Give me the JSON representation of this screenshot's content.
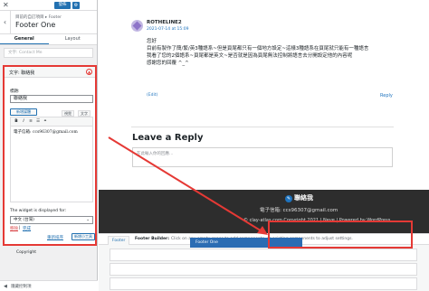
{
  "sidebar": {
    "publish_label": "發佈",
    "breadcrumb": "目前的自訂項目 ▸ Footer",
    "title": "Footer One",
    "tabs": [
      {
        "label": "General",
        "active": true
      },
      {
        "label": "Layout",
        "active": false
      }
    ],
    "contact_item": "文字: Contact Me",
    "bottom_label": "隱藏控制項"
  },
  "widget": {
    "header_label": "文字: 聯絡我",
    "title_label": "標題:",
    "title_value": "聯絡我",
    "add_media_label": "新增媒體",
    "visual_tab": "視覺",
    "text_tab": "文字",
    "editor_content": "電子信箱: ccs96307@gmail.com",
    "display_label": "The widget is displayed for:",
    "display_value": "中文 (台灣)",
    "remove_link": "移除",
    "separator": "|",
    "done_link": "完成",
    "reorder_link": "重新排序",
    "add_widget_label": "新增小工具"
  },
  "comment": {
    "author": "ROTHELINE2",
    "date": "2021-07-14 at 15:09",
    "line1": "您好",
    "line2": "目前有製作了簡/繁/英3種語系~但是頁尾都只有一個地方設定~這樣3種語系在頁尾就只能有一種語言",
    "line3": "我看了您的2個語系~頁尾都是英文~是否就是因為頁尾無法控制將語言去分開設定他的內容呢",
    "line4": "感謝您的回覆 ^_^",
    "edit_label": "(Edit)",
    "reply_label": "Reply"
  },
  "leave_reply": {
    "title": "Leave a Reply",
    "placeholder": "在此輸入你的回應…"
  },
  "site_footer": {
    "widget_title": "聯絡我",
    "email_line": "電子信箱: ccs96307@gmail.com",
    "copyright_line": "© clay-atlas.com Copyright 2021 | Neve | Powered by WordPress"
  },
  "builder": {
    "footer_tab": "Footer",
    "builder_label": "Footer Builder:",
    "hint": "Click on any empty space to add components, or existing components to adjust settings.",
    "slot_label": "Footer One",
    "copyright_label": "Copyright"
  },
  "colors": {
    "highlight": "#e53935",
    "wp_blue": "#2271b1",
    "footer_dark": "#2d2d2d"
  }
}
